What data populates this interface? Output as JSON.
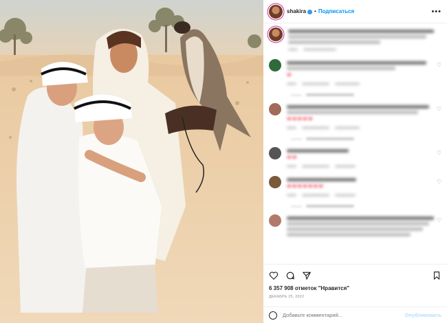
{
  "post": {
    "username": "shakira",
    "follow_label": "Подписаться",
    "likes_text": "6 357 908 отметок \"Нравится\"",
    "date_text": "ДЕКАБРЬ 25, 2022",
    "comment_placeholder": "Добавьте комментарий...",
    "publish_label": "Опубликовать"
  },
  "colors": {
    "accent": "#0095f6",
    "heart": "#ed4956",
    "story_ring": "#d6249f"
  },
  "comments": [
    {
      "hearts": "",
      "has_replies": false
    },
    {
      "hearts": "❤",
      "has_replies": true
    },
    {
      "hearts": "❤❤❤❤❤",
      "has_replies": true
    },
    {
      "hearts": "❤❤",
      "has_replies": false
    },
    {
      "hearts": "❤❤❤❤❤❤❤",
      "has_replies": true
    },
    {
      "hearts": "",
      "has_replies": false
    }
  ]
}
